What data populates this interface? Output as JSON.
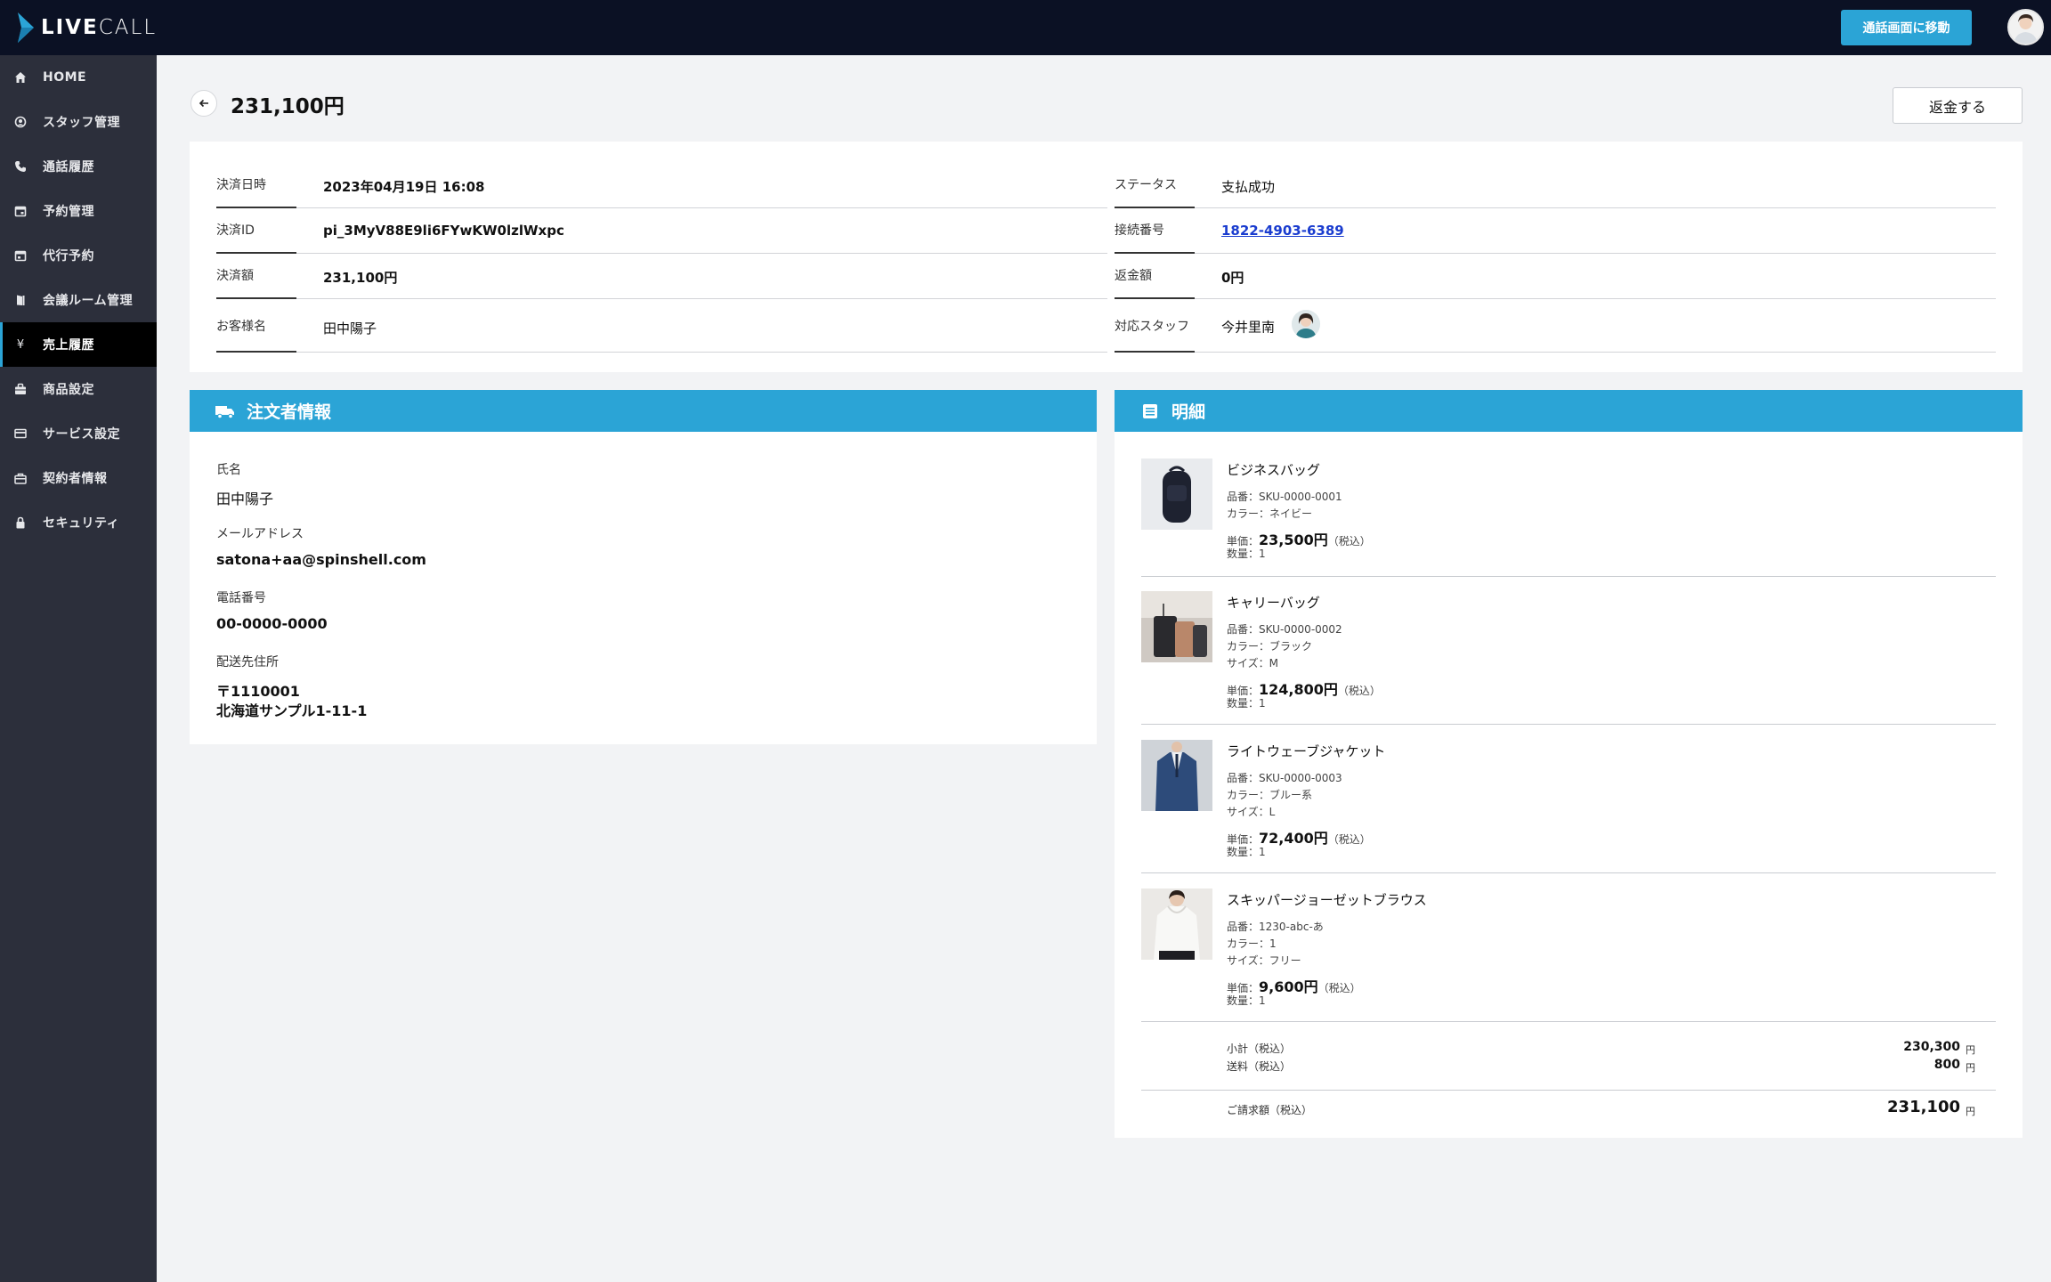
{
  "brand": {
    "logo_bold": "LIVE",
    "logo_light": "CALL"
  },
  "header": {
    "go_to_call_label": "通話画面に移動"
  },
  "sidebar": {
    "items": [
      {
        "label": "HOME",
        "icon": "home-icon"
      },
      {
        "label": "スタッフ管理",
        "icon": "staff-icon"
      },
      {
        "label": "通話履歴",
        "icon": "phone-icon"
      },
      {
        "label": "予約管理",
        "icon": "calendar-icon"
      },
      {
        "label": "代行予約",
        "icon": "calendar-check-icon"
      },
      {
        "label": "会議ルーム管理",
        "icon": "door-icon"
      },
      {
        "label": "売上履歴",
        "icon": "yen-icon"
      },
      {
        "label": "商品設定",
        "icon": "bag-icon"
      },
      {
        "label": "サービス設定",
        "icon": "card-icon"
      },
      {
        "label": "契約者情報",
        "icon": "briefcase-icon"
      },
      {
        "label": "セキュリティ",
        "icon": "lock-icon"
      }
    ],
    "active_index": 6
  },
  "page": {
    "title": "231,100円",
    "refund_label": "返金する"
  },
  "summary": {
    "payment_datetime_label": "決済日時",
    "payment_datetime": "2023年04月19日 16:08",
    "payment_id_label": "決済ID",
    "payment_id": "pi_3MyV88E9li6FYwKW0lzlWxpc",
    "amount_label": "決済額",
    "amount": "231,100円",
    "customer_label": "お客様名",
    "customer": "田中陽子",
    "status_label": "ステータス",
    "status": "支払成功",
    "connection_label": "接続番号",
    "connection": "1822-4903-6389",
    "refund_amount_label": "返金額",
    "refund_amount": "0円",
    "staff_label": "対応スタッフ",
    "staff": "今井里南"
  },
  "orderer": {
    "title": "注文者情報",
    "name_label": "氏名",
    "name": "田中陽子",
    "email_label": "メールアドレス",
    "email": "satona+aa@spinshell.com",
    "phone_label": "電話番号",
    "phone": "00-0000-0000",
    "address_label": "配送先住所",
    "postal": "〒1110001",
    "address": "北海道サンプル1-11-1"
  },
  "details": {
    "title": "明細",
    "items": [
      {
        "name": "ビジネスバッグ",
        "sku": "品番：SKU-0000-0001",
        "color": "カラー：ネイビー",
        "size": "",
        "price_prefix": "単価：",
        "price": "23,500円",
        "tax": "（税込）",
        "qty": "数量：1"
      },
      {
        "name": "キャリーバッグ",
        "sku": "品番：SKU-0000-0002",
        "color": "カラー：ブラック",
        "size": "サイズ：M",
        "price_prefix": "単価：",
        "price": "124,800円",
        "tax": "（税込）",
        "qty": "数量：1"
      },
      {
        "name": "ライトウェーブジャケット",
        "sku": "品番：SKU-0000-0003",
        "color": "カラー：ブルー系",
        "size": "サイズ：L",
        "price_prefix": "単価：",
        "price": "72,400円",
        "tax": "（税込）",
        "qty": "数量：1"
      },
      {
        "name": "スキッパージョーゼットブラウス",
        "sku": "品番：1230-abc-あ",
        "color": "カラー：1",
        "size": "サイズ：フリー",
        "price_prefix": "単価：",
        "price": "9,600円",
        "tax": "（税込）",
        "qty": "数量：1"
      }
    ],
    "subtotal_label": "小計（税込）",
    "subtotal": "230,300",
    "shipping_label": "送料（税込）",
    "shipping": "800",
    "total_label": "ご請求額（税込）",
    "total": "231,100",
    "unit": "円"
  },
  "colors": {
    "accent": "#2ba4d6",
    "topbar": "#0b1124",
    "sidebar": "#2c2f3b",
    "link": "#1a3ccf"
  }
}
